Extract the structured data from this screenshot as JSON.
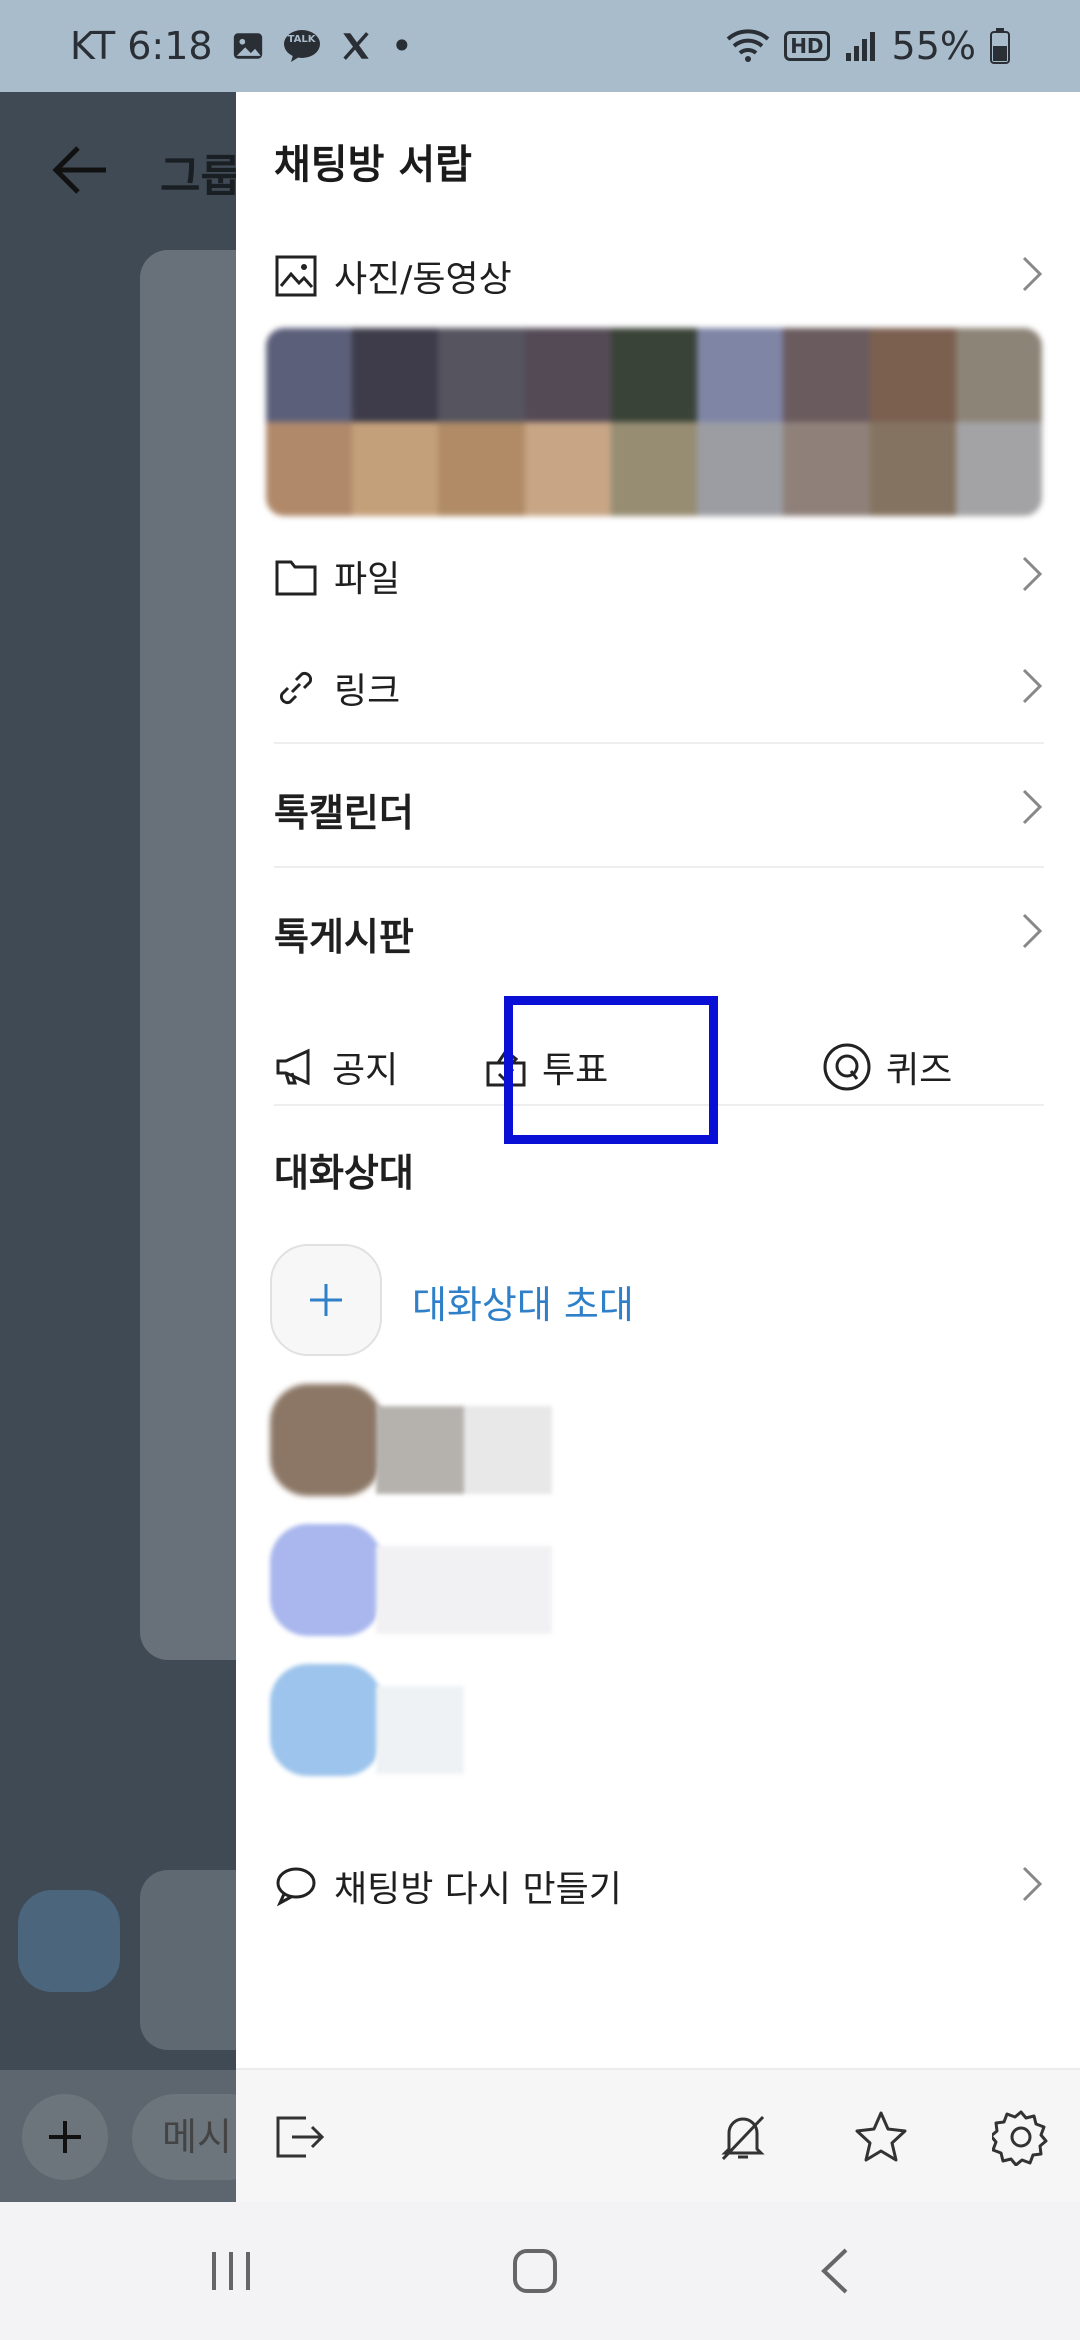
{
  "status_bar": {
    "carrier_time": "KT 6:18",
    "battery": "55%",
    "talk_badge": "TALK",
    "hd_badge": "HD",
    "dot": "•"
  },
  "background": {
    "title_fragment": "그룹",
    "input_placeholder_fragment": "메시"
  },
  "drawer": {
    "title": "채팅방 서랍",
    "media_label": "사진/동영상",
    "file_label": "파일",
    "link_label": "링크",
    "calendar_label": "톡캘린더",
    "board_label": "톡게시판",
    "tools": {
      "notice_label": "공지",
      "vote_label": "투표",
      "quiz_label": "퀴즈"
    },
    "members_section_label": "대화상대",
    "invite_label": "대화상대 초대",
    "recreate_label": "채팅방 다시 만들기"
  },
  "colors": {
    "status_bar_bg": "#a9bccb",
    "accent_blue": "#2f7fc9",
    "highlight_box": "#0a0fd6"
  },
  "icons": {
    "media": "image-icon",
    "file": "folder-icon",
    "link": "link-icon",
    "notice": "megaphone-icon",
    "vote": "ballot-box-icon",
    "quiz": "quiz-q-icon",
    "recreate": "chat-bubble-icon",
    "exit": "exit-icon",
    "mute": "bell-off-icon",
    "favorite": "star-icon",
    "settings": "gear-icon"
  }
}
